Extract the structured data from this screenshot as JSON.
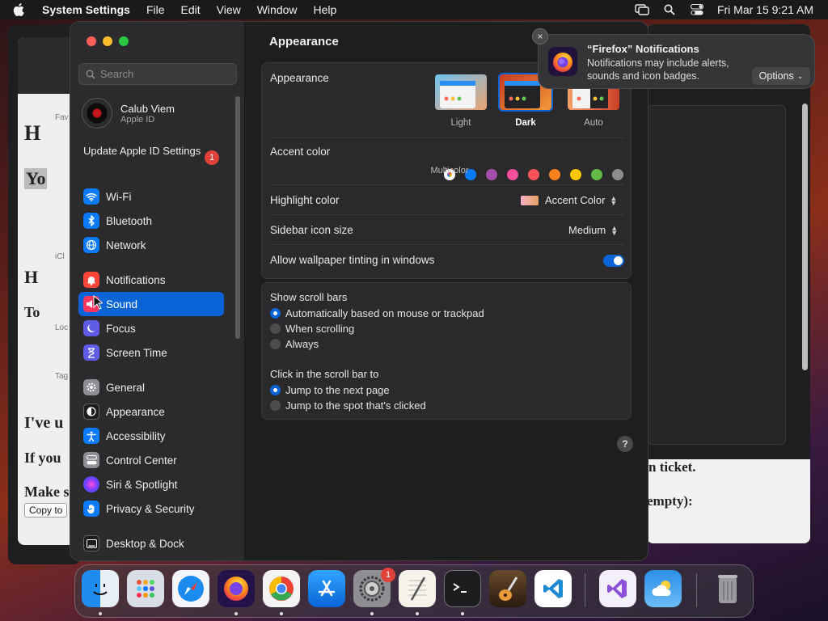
{
  "menubar": {
    "app_name": "System Settings",
    "menus": [
      "File",
      "Edit",
      "View",
      "Window",
      "Help"
    ],
    "datetime": "Fri Mar 15  9:21 AM"
  },
  "background": {
    "left_texts": [
      "H",
      "Yo",
      "H",
      "To",
      "I've u",
      "If you",
      "Make s"
    ],
    "left_copy_button": "Copy to",
    "left_labels": [
      "Fav",
      "iCl",
      "Loc",
      "Tag"
    ],
    "right_texts": [
      "n ticket.",
      "empty):"
    ]
  },
  "sidebar": {
    "search_placeholder": "Search",
    "user_name": "Calub Viem",
    "user_sub": "Apple ID",
    "update_label": "Update Apple ID Settings",
    "update_badge": "1",
    "items": [
      {
        "label": "Wi-Fi"
      },
      {
        "label": "Bluetooth"
      },
      {
        "label": "Network"
      },
      {
        "label": "Notifications"
      },
      {
        "label": "Sound"
      },
      {
        "label": "Focus"
      },
      {
        "label": "Screen Time"
      },
      {
        "label": "General"
      },
      {
        "label": "Appearance"
      },
      {
        "label": "Accessibility"
      },
      {
        "label": "Control Center"
      },
      {
        "label": "Siri & Spotlight"
      },
      {
        "label": "Privacy & Security"
      },
      {
        "label": "Desktop & Dock"
      }
    ]
  },
  "content": {
    "title": "Appearance",
    "appearance_label": "Appearance",
    "modes": [
      {
        "label": "Light"
      },
      {
        "label": "Dark"
      },
      {
        "label": "Auto"
      }
    ],
    "selected_mode": "Dark",
    "accent_label": "Accent color",
    "accent_colors": [
      "#c64fd1",
      "#0a7aff",
      "#a550a7",
      "#f74f9e",
      "#ff5257",
      "#f7821b",
      "#ffc600",
      "#62ba46",
      "#8c8c8c"
    ],
    "accent_caption": "Multicolor",
    "highlight_label": "Highlight color",
    "highlight_value": "Accent Color",
    "sidebar_icon_label": "Sidebar icon size",
    "sidebar_icon_value": "Medium",
    "tinting_label": "Allow wallpaper tinting in windows",
    "tinting_on": true,
    "scroll_title": "Show scroll bars",
    "scroll_options": [
      "Automatically based on mouse or trackpad",
      "When scrolling",
      "Always"
    ],
    "click_title": "Click in the scroll bar to",
    "click_options": [
      "Jump to the next page",
      "Jump to the spot that's clicked"
    ],
    "help": "?"
  },
  "notification": {
    "title": "“Firefox” Notifications",
    "body": "Notifications may include alerts, sounds and icon badges.",
    "options_label": "Options",
    "close": "×"
  },
  "dock": {
    "apps": [
      "Finder",
      "Launchpad",
      "Safari",
      "Firefox",
      "Chrome",
      "App Store",
      "System Settings",
      "TextEdit",
      "Terminal",
      "GarageBand",
      "Visual Studio Code",
      "Visual Studio",
      "Weather",
      "Trash"
    ],
    "settings_badge": "1"
  },
  "colors": {
    "accent": "#0a64d8",
    "badge": "#e0423a"
  }
}
